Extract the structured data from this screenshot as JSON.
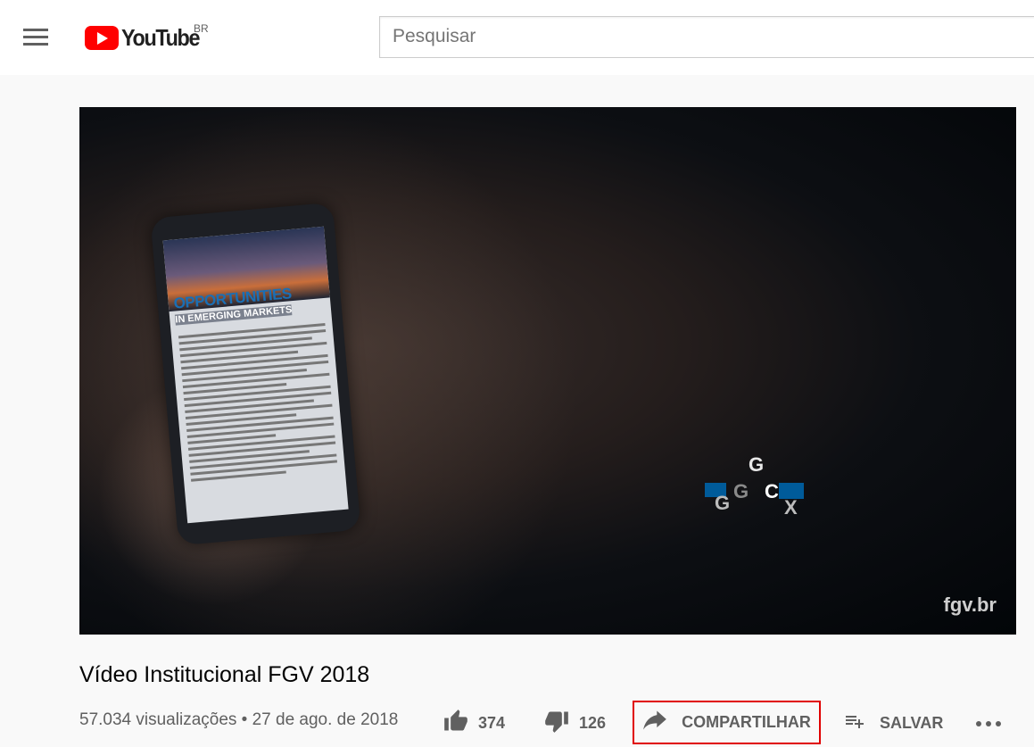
{
  "header": {
    "logo_text": "YouTube",
    "logo_country": "BR",
    "search_placeholder": "Pesquisar",
    "menu_icon": "hamburger-menu-icon"
  },
  "video": {
    "phone_headline": "OPPORTUNITIES",
    "phone_subhead": "IN EMERGING MARKETS",
    "logo_letters": [
      "G",
      "G",
      "C",
      "G",
      "X"
    ],
    "watermark": "fgv.br",
    "colors": {
      "accent": "#005b9a",
      "background": "#050a10"
    }
  },
  "info": {
    "title": "Vídeo Institucional FGV 2018",
    "meta": "57.034 visualizações • 27 de ago. de 2018"
  },
  "actions": {
    "like_count": "374",
    "dislike_count": "126",
    "share_label": "COMPARTILHAR",
    "save_label": "SALVAR",
    "more_icon": "more-horizontal-icon"
  },
  "colors": {
    "brand": "#ff0000",
    "highlight_border": "#e00000",
    "text_secondary": "#606060"
  }
}
